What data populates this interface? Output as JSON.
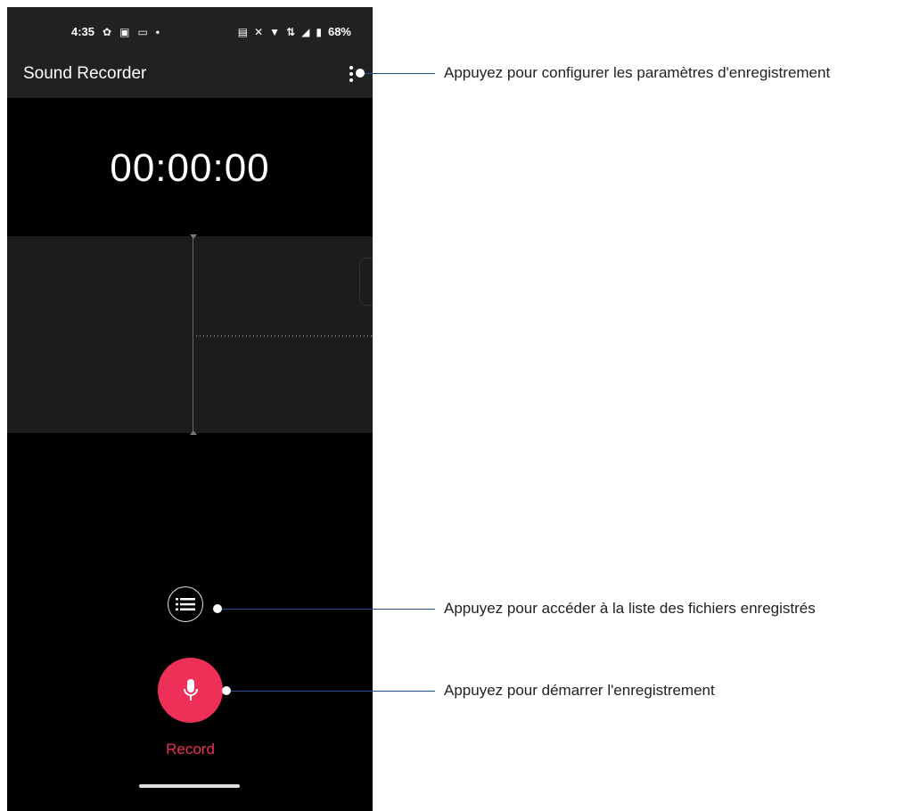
{
  "status_bar": {
    "time": "4:35",
    "battery": "68%",
    "left_icons": [
      "settings-icon",
      "screen-record-icon",
      "gallery-icon",
      "dot-icon"
    ],
    "right_icons": [
      "nfc-icon",
      "mute-icon",
      "wifi-icon",
      "lte-icon",
      "signal-icon",
      "battery-icon"
    ]
  },
  "app_bar": {
    "title": "Sound Recorder",
    "menu_icon": "more-vert-icon"
  },
  "timer": "00:00:00",
  "controls": {
    "list_icon": "list-icon",
    "record_icon": "microphone-icon",
    "record_label": "Record",
    "record_color": "#ee2f58"
  },
  "callouts": [
    {
      "text": "Appuyez pour configurer les paramètres d'enregistrement"
    },
    {
      "text": "Appuyez pour accéder à la liste des fichiers enregistrés"
    },
    {
      "text": "Appuyez pour démarrer l'enregistrement"
    }
  ],
  "colors": {
    "callout_line": "#1f4f8f",
    "app_bar": "#212121",
    "waveform_bg": "#1c1c1c"
  }
}
